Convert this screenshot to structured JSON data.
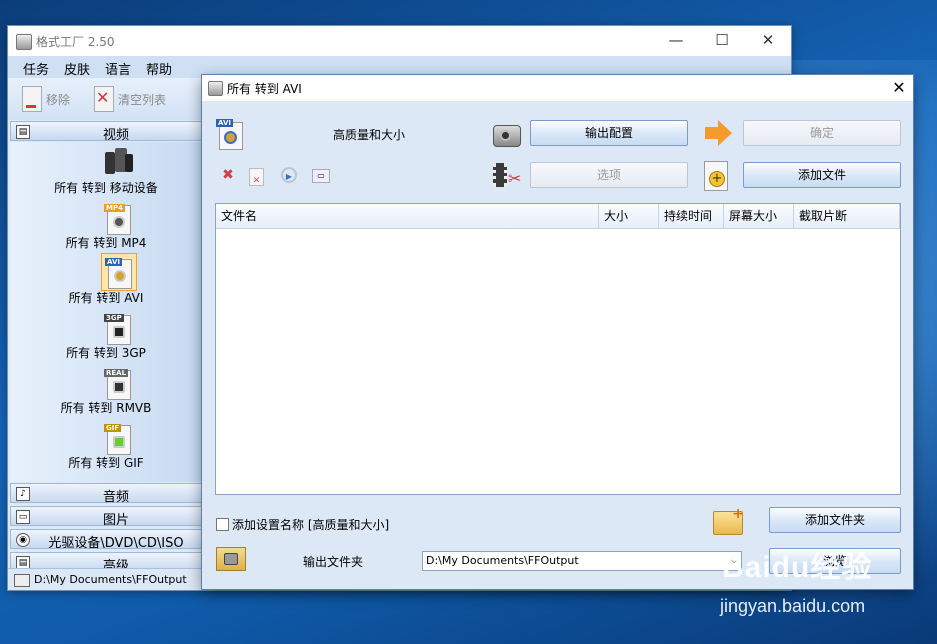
{
  "main_window": {
    "title": "格式工厂 2.50",
    "caption_min": "—",
    "caption_max": "☐",
    "caption_close": "✕"
  },
  "menu": [
    "任务",
    "皮肤",
    "语言",
    "帮助"
  ],
  "toolbar": {
    "remove": "移除",
    "clear_list": "清空列表"
  },
  "sidebar": {
    "video_section": "视频",
    "video_items": [
      "所有 转到 移动设备",
      "所有 转到 MP4",
      "所有 转到 AVI",
      "所有 转到 3GP",
      "所有 转到 RMVB",
      "所有 转到 GIF"
    ],
    "selected_index": 2,
    "sections": [
      "音频",
      "图片",
      "光驱设备\\DVD\\CD\\ISO",
      "高级"
    ],
    "output_path": "D:\\My Documents\\FFOutput"
  },
  "dialog": {
    "title": "所有 转到 AVI",
    "close": "✕",
    "quality_label": "高质量和大小",
    "output_config_button": "输出配置",
    "ok_button": "确定",
    "options_button": "选项",
    "add_file_button": "添加文件",
    "table_columns": [
      "文件名",
      "大小",
      "持续时间",
      "屏幕大小",
      "截取片断"
    ],
    "add_setting_name": "添加设置名称 [高质量和大小]",
    "add_folder_button": "添加文件夹",
    "output_folder_label": "输出文件夹",
    "output_folder_value": "D:\\My Documents\\FFOutput",
    "browse_button": "浏览"
  },
  "watermark": {
    "line1": "Baidu经验",
    "line2": "jingyan.baidu.com"
  },
  "colors": {
    "accent": "#f39b2b",
    "selection_border": "#f0a030",
    "panel": "#dde8f6"
  }
}
